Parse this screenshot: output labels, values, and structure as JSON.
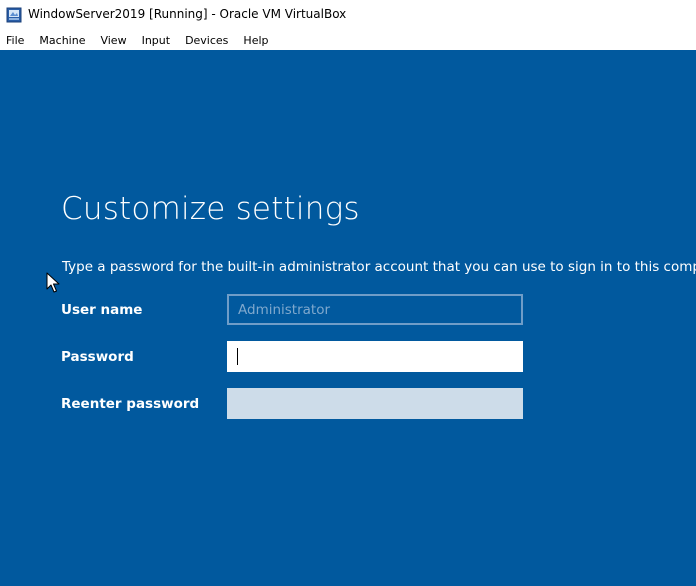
{
  "window": {
    "title": "WindowServer2019 [Running] - Oracle VM VirtualBox"
  },
  "menu": {
    "items": [
      "File",
      "Machine",
      "View",
      "Input",
      "Devices",
      "Help"
    ]
  },
  "setup": {
    "title": "Customize settings",
    "description": "Type a password for the built-in administrator account that you can use to sign in to this computer.",
    "username_label": "User name",
    "username_placeholder": "Administrator",
    "password_label": "Password",
    "password_value": "",
    "reenter_label": "Reenter password",
    "reenter_value": ""
  },
  "colors": {
    "background": "#01599e",
    "text": "#ffffff",
    "disabled_field": "#cddce9"
  },
  "icons": {
    "app": "virtualbox-icon",
    "pointer": "mouse-pointer-icon"
  }
}
